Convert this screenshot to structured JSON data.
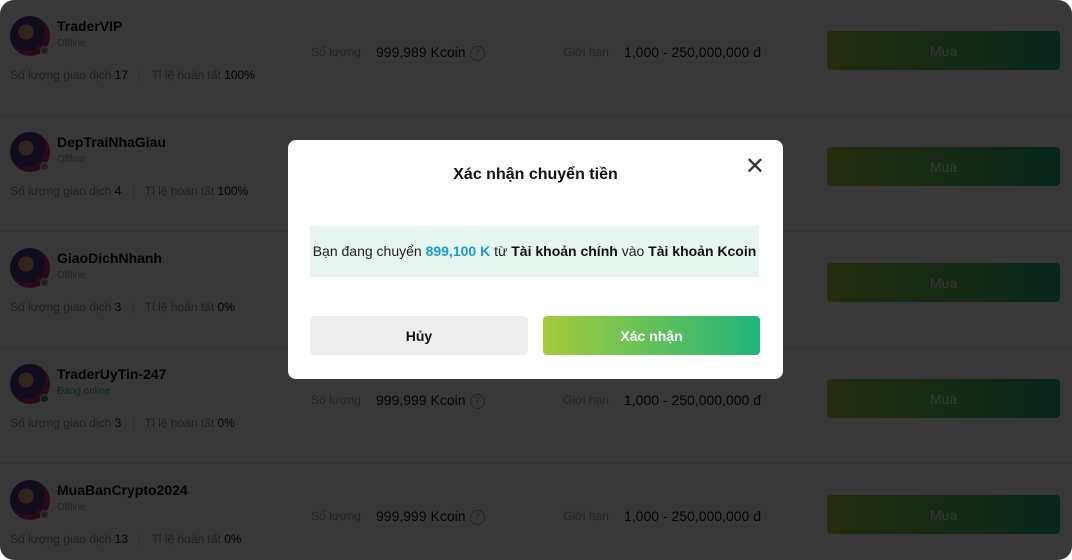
{
  "labels": {
    "quantity": "Số lượng",
    "limit": "Giới hạn",
    "trades": "Số lượng giao dịch",
    "completion": "Tỉ lệ hoàn tất",
    "buy": "Mua",
    "help": "?"
  },
  "traders": [
    {
      "name": "TraderVIP",
      "status": "Offline",
      "online": false,
      "trades": "17",
      "completion": "100%",
      "quantity": "999,989 Kcoin",
      "limit": "1,000 - 250,000,000 đ"
    },
    {
      "name": "DepTraiNhaGiau",
      "status": "Offline",
      "online": false,
      "trades": "4",
      "completion": "100%"
    },
    {
      "name": "GiaoDichNhanh",
      "status": "Offline",
      "online": false,
      "trades": "3",
      "completion": "0%"
    },
    {
      "name": "TraderUyTin-247",
      "status": "Đang online",
      "online": true,
      "trades": "3",
      "completion": "0%",
      "quantity": "999,999 Kcoin",
      "limit": "1,000 - 250,000,000 đ"
    },
    {
      "name": "MuaBanCrypto2024",
      "status": "Offline",
      "online": false,
      "trades": "13",
      "completion": "0%",
      "quantity": "999,999 Kcoin",
      "limit": "1,000 - 250,000,000 đ"
    }
  ],
  "modal": {
    "title": "Xác nhận chuyển tiền",
    "close_icon": "close-icon",
    "msg_prefix": "Bạn đang chuyển",
    "amount": "899,100 K",
    "msg_from": "từ",
    "source": "Tài khoản chính",
    "msg_to": "vào",
    "target": "Tài khoản Kcoin",
    "cancel": "Hủy",
    "confirm": "Xác nhận"
  },
  "colors": {
    "accent_start": "#a6cc3a",
    "accent_end": "#1fb57a",
    "amount": "#1a9ad6",
    "online": "#2ea84a"
  }
}
